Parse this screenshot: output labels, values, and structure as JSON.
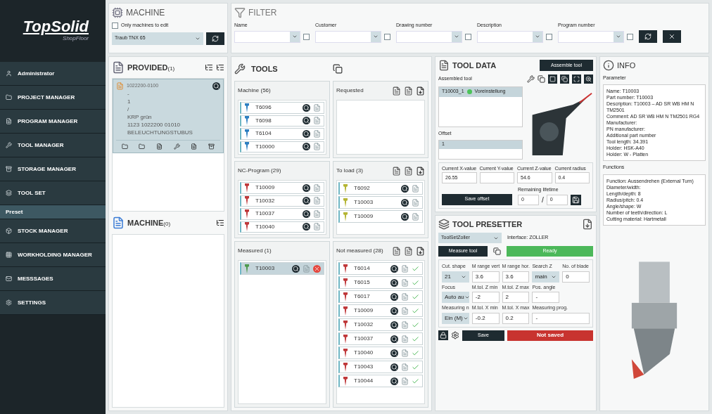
{
  "sidebar": {
    "logo": "TopSolid",
    "logo_sub": "ShopFloor",
    "items": [
      {
        "label": "Administrator",
        "kind": "user",
        "selected": false
      },
      {
        "label": "PROJECT MANAGER",
        "kind": "folder",
        "selected": false
      },
      {
        "label": "PROGRAM MANAGER",
        "kind": "file",
        "selected": false
      },
      {
        "label": "TOOL MANAGER",
        "kind": "tool",
        "selected": false
      },
      {
        "label": "STORAGE MANAGER",
        "kind": "storage",
        "selected": false
      },
      {
        "label": "TOOL SET",
        "kind": "set",
        "selected": false
      },
      {
        "label": "Preset",
        "kind": "sub",
        "selected": true
      },
      {
        "label": "STOCK MANAGER",
        "kind": "stock",
        "selected": false
      },
      {
        "label": "WORKHOLDING MANAGER",
        "kind": "workholding",
        "selected": false
      },
      {
        "label": "MESSSAGES",
        "kind": "mail",
        "selected": false
      },
      {
        "label": "SETTINGS",
        "kind": "settings",
        "selected": false
      }
    ]
  },
  "machine": {
    "title": "MACHINE",
    "only_edit": {
      "label": "Only machines to edit",
      "checked": false
    },
    "value": "Traub TNX 65"
  },
  "filter": {
    "title": "FILTER",
    "fields": [
      {
        "label": "Name",
        "checked": false
      },
      {
        "label": "Customer",
        "checked": false
      },
      {
        "label": "Drawing number",
        "checked": false
      },
      {
        "label": "Description",
        "checked": false
      },
      {
        "label": "Program number",
        "checked": false
      }
    ]
  },
  "provided": {
    "title": "PROVIDED",
    "count": "(1)",
    "card": {
      "name": "1022200-0100",
      "lines": [
        "-",
        "1",
        "/",
        "KRP grün",
        "1123 1022200 01010",
        "BELEUCHTUNGSTUBUS"
      ]
    }
  },
  "machine_list": {
    "title": "MACHINE",
    "count": "(0)"
  },
  "tools": {
    "title": "TOOLS",
    "groups": [
      {
        "title": "Machine (56)",
        "actions": false,
        "tools": [
          {
            "name": "T6096",
            "color": "#2f7fc1",
            "kind": "plain",
            "selected": false
          },
          {
            "name": "T6098",
            "color": "#2f7fc1",
            "kind": "plain",
            "selected": false
          },
          {
            "name": "T6104",
            "color": "#2f7fc1",
            "kind": "plain",
            "selected": false
          },
          {
            "name": "T10000",
            "color": "#2f7fc1",
            "kind": "plain",
            "selected": false
          }
        ]
      },
      {
        "title": "Requested",
        "actions": true
      },
      {
        "title": "NC-Program (29)",
        "actions": false,
        "tools": [
          {
            "name": "T10009",
            "color": "#c0393b",
            "kind": "plain",
            "selected": false
          },
          {
            "name": "T10032",
            "color": "#c0393b",
            "kind": "plain",
            "selected": false
          },
          {
            "name": "T10037",
            "color": "#c0393b",
            "kind": "plain",
            "selected": false
          },
          {
            "name": "T10040",
            "color": "#c0393b",
            "kind": "plain",
            "selected": false
          }
        ]
      },
      {
        "title": "To load (3)",
        "actions": true,
        "tools": [
          {
            "name": "T6092",
            "color": "#b5b534",
            "kind": "plain",
            "selected": false
          },
          {
            "name": "T10003",
            "color": "#b5b534",
            "kind": "plain",
            "selected": false
          },
          {
            "name": "T10009",
            "color": "#b5b534",
            "kind": "plain",
            "selected": false
          }
        ]
      },
      {
        "title": "Measured (1)",
        "actions": false,
        "tools": [
          {
            "name": "T10003",
            "color": "#4e9a4e",
            "kind": "error",
            "selected": true
          }
        ]
      },
      {
        "title": "Not measured (28)",
        "actions": true,
        "tools": [
          {
            "name": "T6014",
            "color": "#c0393b",
            "kind": "checked",
            "selected": false
          },
          {
            "name": "T6015",
            "color": "#c0393b",
            "kind": "checked",
            "selected": false
          },
          {
            "name": "T6017",
            "color": "#c0393b",
            "kind": "checked",
            "selected": false
          },
          {
            "name": "T10009",
            "color": "#c0393b",
            "kind": "checked",
            "selected": false
          },
          {
            "name": "T10032",
            "color": "#c0393b",
            "kind": "checked",
            "selected": false
          },
          {
            "name": "T10037",
            "color": "#c0393b",
            "kind": "checked",
            "selected": false
          },
          {
            "name": "T10040",
            "color": "#c0393b",
            "kind": "checked",
            "selected": false
          },
          {
            "name": "T10043",
            "color": "#c0393b",
            "kind": "checked",
            "selected": false
          },
          {
            "name": "T10044",
            "color": "#c0393b",
            "kind": "checked",
            "selected": false
          }
        ]
      }
    ]
  },
  "tool_data": {
    "title": "TOOL DATA",
    "assemble_button": "Assemble tool",
    "assembled_label": "Assembled tool",
    "assembled": [
      {
        "name": "T10003_1",
        "status": "Voreinstellung",
        "selected": true
      }
    ],
    "offset_label": "Offset",
    "offsets": [
      {
        "name": "1",
        "selected": true
      }
    ],
    "values": [
      {
        "label": "Current X-value",
        "value": "26.55"
      },
      {
        "label": "Current Y-value"
      },
      {
        "label": "Current Z-value",
        "value": "54.6"
      },
      {
        "label": "Current radius",
        "value": "0.4"
      }
    ],
    "save_offset": "Save offset",
    "lifetime_label": "Remaining lifetime",
    "lifetime": [
      "0",
      "0"
    ],
    "separator": "/"
  },
  "presetter": {
    "title": "TOOL PRESETTER",
    "device": "ToolSetZoller",
    "interface": "Interface: ZOLLER",
    "measure_button": "Measure tool",
    "status": "Ready",
    "fields": [
      {
        "label": "Cut. shape",
        "value": "21",
        "kind": "select"
      },
      {
        "label": "M range vert",
        "value": "3.6",
        "kind": "input"
      },
      {
        "label": "M range hor.",
        "value": "3.6",
        "kind": "input"
      },
      {
        "label": "Search Z",
        "value": "main",
        "kind": "select"
      },
      {
        "label": "No. of blade",
        "value": "0",
        "kind": "input"
      },
      {
        "label": "Focus",
        "value": "Auto au",
        "kind": "select"
      },
      {
        "label": "M.tol. Z min",
        "value": "-2",
        "kind": "input"
      },
      {
        "label": "M.tol. Z max",
        "value": "2",
        "kind": "input"
      },
      {
        "label": "Pos. angle",
        "value": "-",
        "kind": "input"
      },
      {
        "kind": "gap"
      },
      {
        "label": "Measuring n",
        "value": "Ein (M)",
        "kind": "select"
      },
      {
        "label": "M.tol. X min",
        "value": "-0.2",
        "kind": "input"
      },
      {
        "label": "M.tol. X max",
        "value": "0.2",
        "kind": "input"
      },
      {
        "label": "Measuring prog.",
        "value": "-",
        "kind": "wide"
      }
    ],
    "save": "Save",
    "save_state": "Not saved"
  },
  "info": {
    "title": "INFO",
    "parameter_label": "Parameter",
    "parameters": [
      "Name: T10003",
      "Part number: T10003",
      "Description: T10003 – AD SR WB HM N TM2501",
      "Comment: AD SR WB HM N TM2501 RG4",
      "Manufacturer:",
      "PN manufacturer:",
      "Additional part number",
      "Tool length: 34.391",
      "Holder: HSK-A40",
      "Holder: W - Platten"
    ],
    "functions_label": "Functions",
    "functions": [
      "Function: Aussendrehen (External Turn)",
      "Diameter/width:",
      "Length/depth: 8",
      "Radius/pitch: 0.4",
      "Angle/shape: W",
      "Number of teeth/direction: L",
      "Cutting material: Hartmetall"
    ]
  }
}
